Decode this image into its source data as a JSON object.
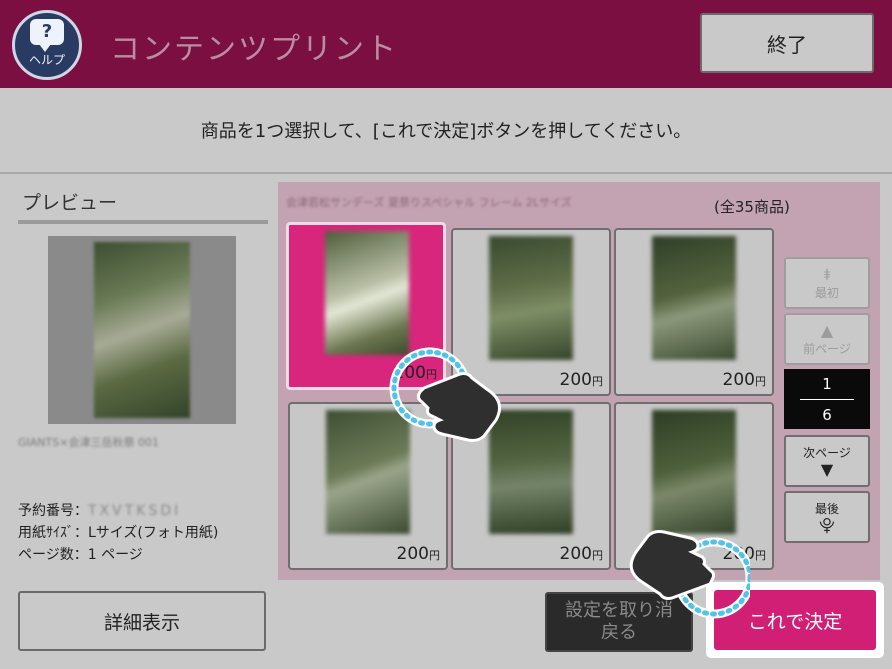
{
  "header": {
    "help_label": "ヘルプ",
    "help_icon": "chat-bubble-question-icon",
    "help_glyph": "?",
    "title": "コンテンツプリント",
    "end_button": "終了"
  },
  "instruction": "商品を1つ選択して、[これで決定]ボタンを押してください。",
  "preview": {
    "title": "プレビュー",
    "caption": "GIANTS×会津三岳秋祭 001",
    "reservation_label": "予約番号：",
    "reservation_value": "TXVTKSDI",
    "paper_size_label": "用紙ｻｲｽﾞ：",
    "paper_size_value": "Lサイズ(フォト用紙)",
    "page_count_label": "ページ数：",
    "page_count_value": "1 ページ",
    "detail_button": "詳細表示"
  },
  "grid": {
    "heading": "会津若松サンデーズ 夏祭りスペシャル フレーム 2Lサイズ",
    "count": "(全35商品)",
    "price_unit": "円",
    "items": [
      {
        "price": "200",
        "selected": true
      },
      {
        "price": "200",
        "selected": false
      },
      {
        "price": "200",
        "selected": false
      },
      {
        "price": "200",
        "selected": false
      },
      {
        "price": "200",
        "selected": false
      },
      {
        "price": "200",
        "selected": false
      }
    ]
  },
  "pager": {
    "first": "最初",
    "prev": "前ページ",
    "current": "1",
    "total": "6",
    "next": "次ページ",
    "last": "最後"
  },
  "actions": {
    "cancel_line1": "設定を取り消",
    "cancel_line2": "戻る",
    "confirm": "これで決定"
  },
  "colors": {
    "header_bg": "#7c0f42",
    "accent": "#d11f75",
    "selected_cell": "#d8267c",
    "tap_ring": "#4fc3ea"
  }
}
